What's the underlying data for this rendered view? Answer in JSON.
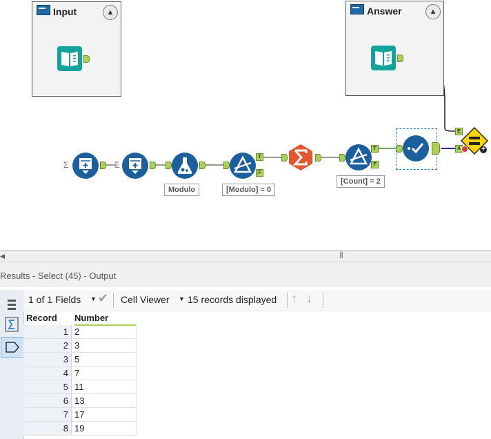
{
  "containers": {
    "input": {
      "title": "Input"
    },
    "answer": {
      "title": "Answer"
    }
  },
  "tools": {
    "formula_label": "Modulo",
    "filter1_label": "[Modulo] = 0",
    "filter2_label": "[Count] = 2"
  },
  "anchors": {
    "true": "T",
    "false": "F",
    "e": "E",
    "a": "A"
  },
  "results": {
    "header": "Results - Select (45) - Output",
    "fields": "1 of 1 Fields",
    "viewer": "Cell Viewer",
    "records": "15 records displayed"
  },
  "table": {
    "columns": [
      "Record",
      "Number"
    ],
    "rows": [
      {
        "record": "1",
        "number": "2"
      },
      {
        "record": "2",
        "number": "3"
      },
      {
        "record": "3",
        "number": "5"
      },
      {
        "record": "4",
        "number": "7"
      },
      {
        "record": "5",
        "number": "11"
      },
      {
        "record": "6",
        "number": "13"
      },
      {
        "record": "7",
        "number": "17"
      },
      {
        "record": "8",
        "number": "19"
      }
    ]
  },
  "colors": {
    "tool_blue": "#1b5f9e",
    "tool_teal": "#14a39a",
    "summarize_orange": "#e4572e",
    "anchor_green": "#a9d15a",
    "test_yellow": "#ffd400"
  },
  "icons": {
    "input_tool": "book-icon",
    "generate_rows": "generate-rows-icon",
    "formula": "flask-icon",
    "filter": "filter-icon",
    "summarize": "sigma-icon",
    "select": "checkmark-icon",
    "test": "equals-icon"
  }
}
